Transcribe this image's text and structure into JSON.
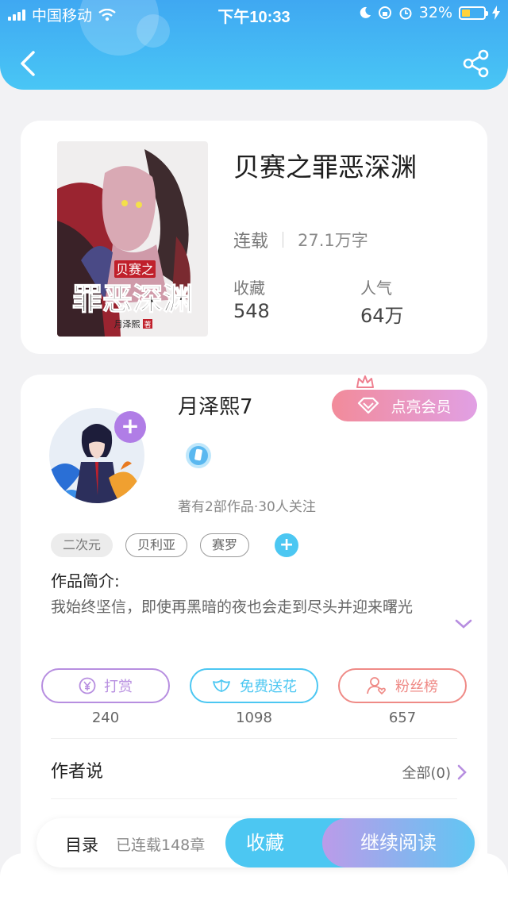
{
  "status_bar": {
    "carrier": "中国移动",
    "time": "下午10:33",
    "battery": "32%",
    "battery_level": 0.32
  },
  "book": {
    "title": "贝赛之罪恶深渊",
    "status": "连载",
    "word_count": "27.1万字",
    "stats": [
      {
        "label": "收藏",
        "value": "548"
      },
      {
        "label": "人气",
        "value": "64万"
      }
    ],
    "cover": {
      "title_small": "贝赛之",
      "title_big": "罪恶深渊",
      "author": "月泽熙",
      "author_mark": "著"
    }
  },
  "author": {
    "name": "月泽熙7",
    "member_button": "点亮会员",
    "meta": "著有2部作品·30人关注",
    "tags": [
      "二次元",
      "贝利亚",
      "赛罗"
    ],
    "intro_heading": "作品简介:",
    "intro_text": "我始终坚信，即使再黑暗的夜也会走到尽头并迎来曙光"
  },
  "actions": [
    {
      "label": "打赏",
      "count": "240",
      "color": "#b78ee0"
    },
    {
      "label": "免费送花",
      "count": "1098",
      "color": "#4cc7f2"
    },
    {
      "label": "粉丝榜",
      "count": "657",
      "color": "#ef8a86"
    }
  ],
  "author_says": {
    "heading": "作者说",
    "all_link": "全部(0)"
  },
  "bottom_bar": {
    "toc": "目录",
    "chapters": "已连载148章",
    "favorite": "收藏",
    "continue": "继续阅读"
  },
  "colors": {
    "header": "#3fa8f2",
    "accent_blue": "#4cc7f2",
    "accent_purple": "#b07de6",
    "member_pink": "#f28b9a"
  }
}
